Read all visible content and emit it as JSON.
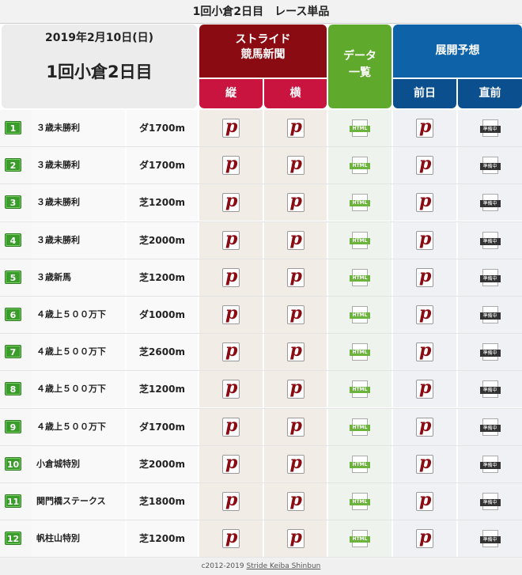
{
  "header": {
    "title": "1回小倉2日目　レース単品",
    "date": "2019年2月10日(日)",
    "meeting": "1回小倉2日目",
    "stride_line1": "ストライド",
    "stride_line2": "競馬新聞",
    "tate": "縦",
    "yoko": "横",
    "data_line1": "データ",
    "data_line2": "一覧",
    "tenkai": "展開予想",
    "zenjitsu": "前日",
    "chokuzen": "直前"
  },
  "icons": {
    "pdf_letter": "p",
    "html_label": "HTML",
    "ready_label": "準備中"
  },
  "races": [
    {
      "num": "1",
      "name": "３歳未勝利",
      "dist": "ダ1700m"
    },
    {
      "num": "2",
      "name": "３歳未勝利",
      "dist": "ダ1700m"
    },
    {
      "num": "3",
      "name": "３歳未勝利",
      "dist": "芝1200m"
    },
    {
      "num": "4",
      "name": "３歳未勝利",
      "dist": "芝2000m"
    },
    {
      "num": "5",
      "name": "３歳新馬",
      "dist": "芝1200m"
    },
    {
      "num": "6",
      "name": "４歳上５００万下",
      "dist": "ダ1000m"
    },
    {
      "num": "7",
      "name": "４歳上５００万下",
      "dist": "芝2600m"
    },
    {
      "num": "8",
      "name": "４歳上５００万下",
      "dist": "芝1200m"
    },
    {
      "num": "9",
      "name": "４歳上５００万下",
      "dist": "ダ1700m"
    },
    {
      "num": "10",
      "name": "小倉城特別",
      "dist": "芝2000m"
    },
    {
      "num": "11",
      "name": "関門橋ステークス",
      "dist": "芝1800m"
    },
    {
      "num": "12",
      "name": "帆柱山特別",
      "dist": "芝1200m"
    }
  ],
  "footer": {
    "copyright": "c2012-2019 ",
    "link": "Stride Keiba Shinbun"
  }
}
